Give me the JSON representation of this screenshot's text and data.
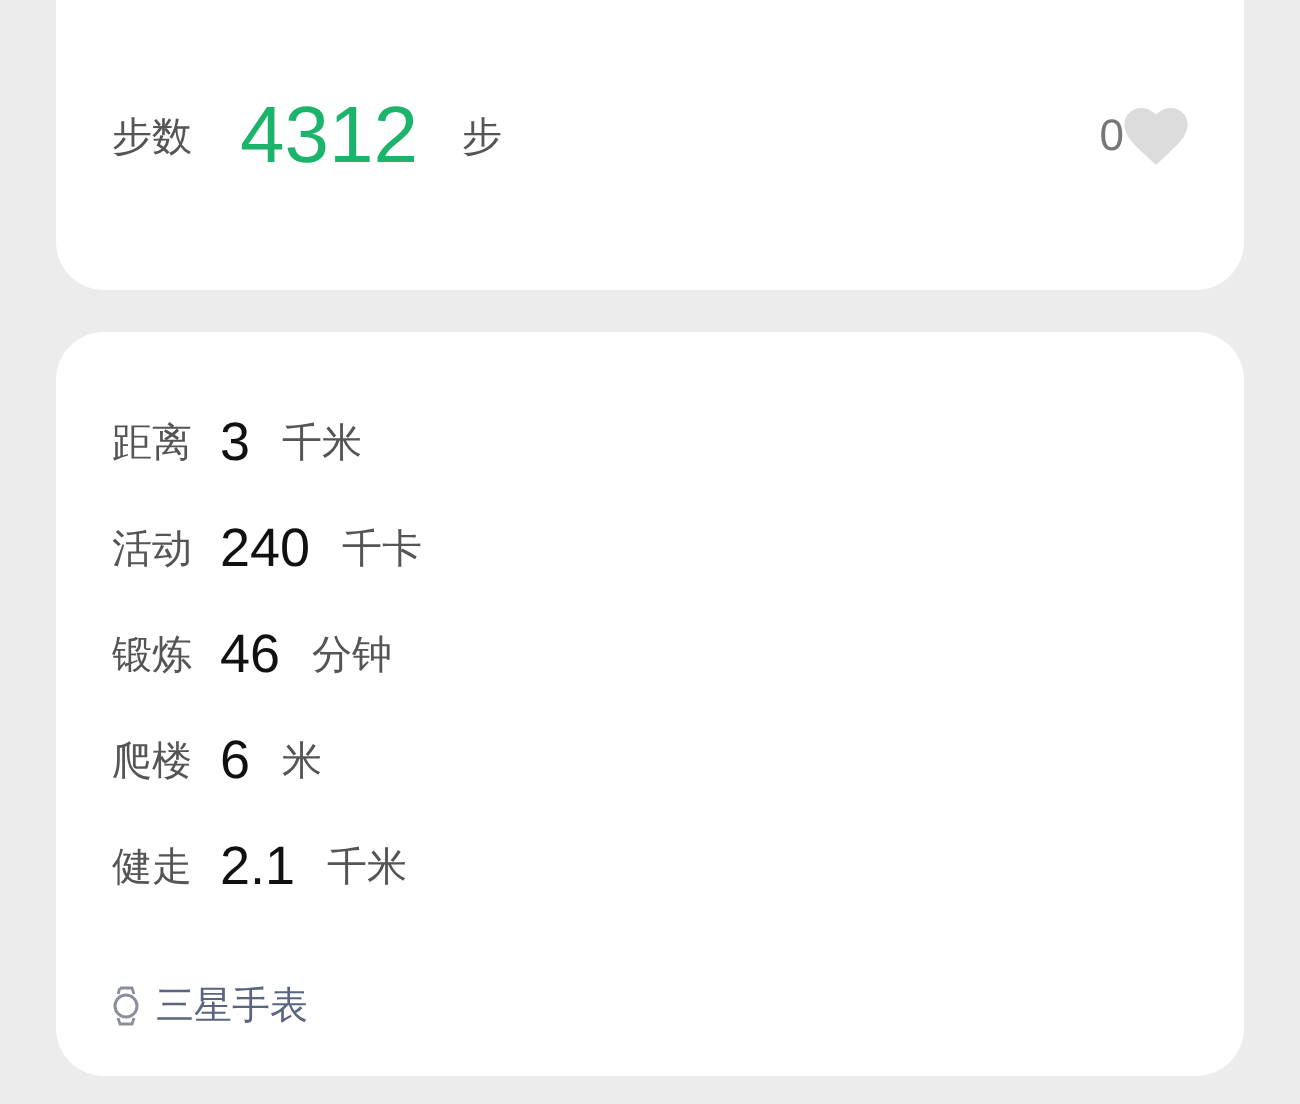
{
  "steps": {
    "label": "步数",
    "value": "4312",
    "unit": "步",
    "likes": "0",
    "liked": false
  },
  "metrics": [
    {
      "label": "距离",
      "value": "3",
      "unit": "千米"
    },
    {
      "label": "活动",
      "value": "240",
      "unit": "千卡"
    },
    {
      "label": "锻炼",
      "value": "46",
      "unit": "分钟"
    },
    {
      "label": "爬楼",
      "value": "6",
      "unit": "米"
    },
    {
      "label": "健走",
      "value": "2.1",
      "unit": "千米"
    }
  ],
  "source": {
    "label": "三星手表"
  }
}
